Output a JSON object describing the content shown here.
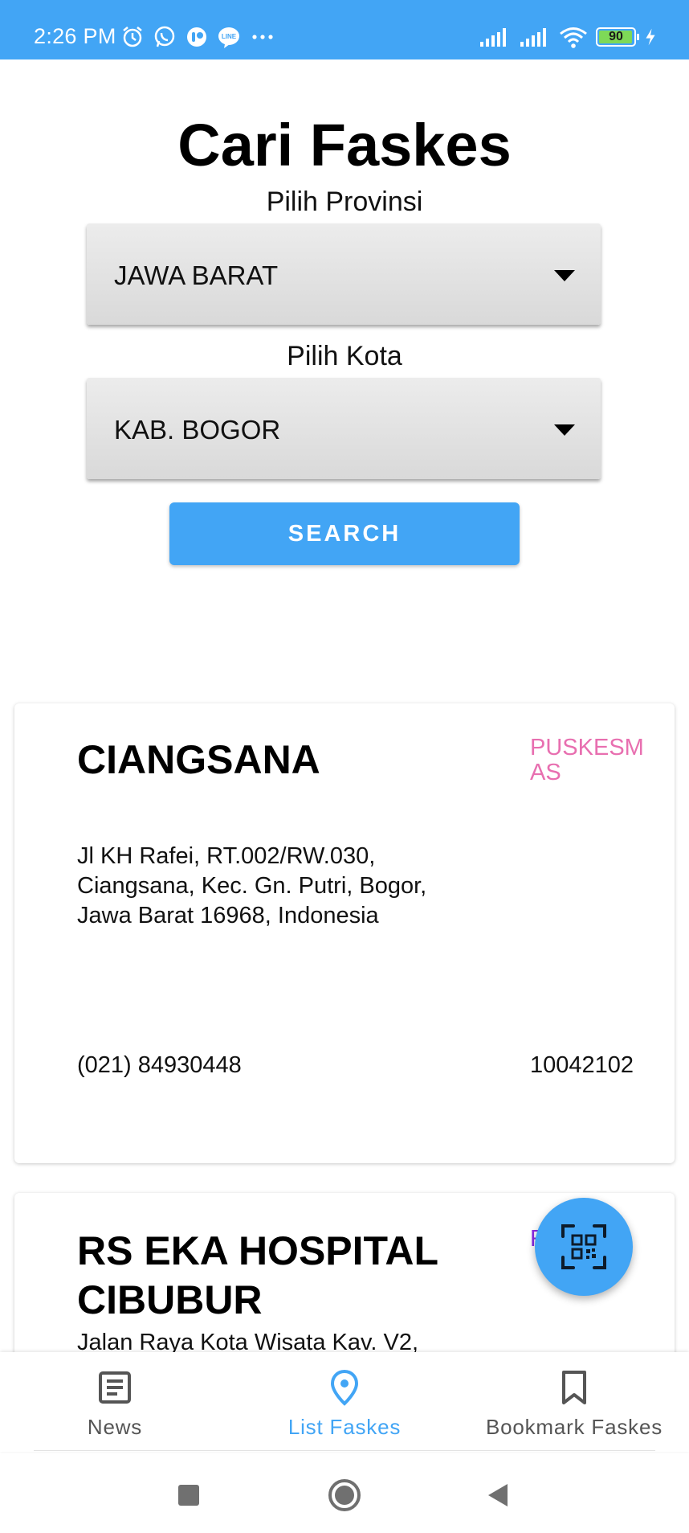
{
  "status_bar": {
    "time": "2:26 PM",
    "left_icons": [
      "alarm-icon",
      "whatsapp-icon",
      "messenger-icon",
      "line-icon",
      "more-dots-icon"
    ],
    "right_icons": [
      "signal-icon",
      "signal-icon",
      "wifi-icon",
      "battery-icon",
      "charging-icon"
    ],
    "battery": "90",
    "battery_level": 0.9,
    "color": "#42a5f5"
  },
  "header": {
    "title": "Cari Faskes",
    "province_label": "Pilih Provinsi",
    "province_value": "JAWA BARAT",
    "city_label": "Pilih Kota",
    "city_value": "KAB. BOGOR",
    "search_label": "SEARCH"
  },
  "results": [
    {
      "name": "CIANGSANA",
      "type": "PUSKESMAS",
      "type_color": "#e86fb0",
      "address": "Jl KH Rafei, RT.002/RW.030, Ciangsana, Kec. Gn. Putri, Bogor, Jawa Barat 16968, Indonesia",
      "phone": "(021) 84930448",
      "code": "10042102"
    },
    {
      "name": "RS EKA HOSPITAL CIBUBUR",
      "type": "RS",
      "type_color": "#8a2be2",
      "address": "Jalan Raya Kota Wisata Kav. V2,"
    }
  ],
  "fab": {
    "icon": "qr-scan-icon"
  },
  "bottom_nav": {
    "active_color": "#42a5f5",
    "items": [
      {
        "label": "News",
        "icon": "news-icon",
        "active": false
      },
      {
        "label": "List Faskes",
        "icon": "location-pin-icon",
        "active": true
      },
      {
        "label": "Bookmark Faskes",
        "icon": "bookmark-icon",
        "active": false
      }
    ]
  },
  "system_nav": [
    "recents-icon",
    "home-icon",
    "back-icon"
  ]
}
